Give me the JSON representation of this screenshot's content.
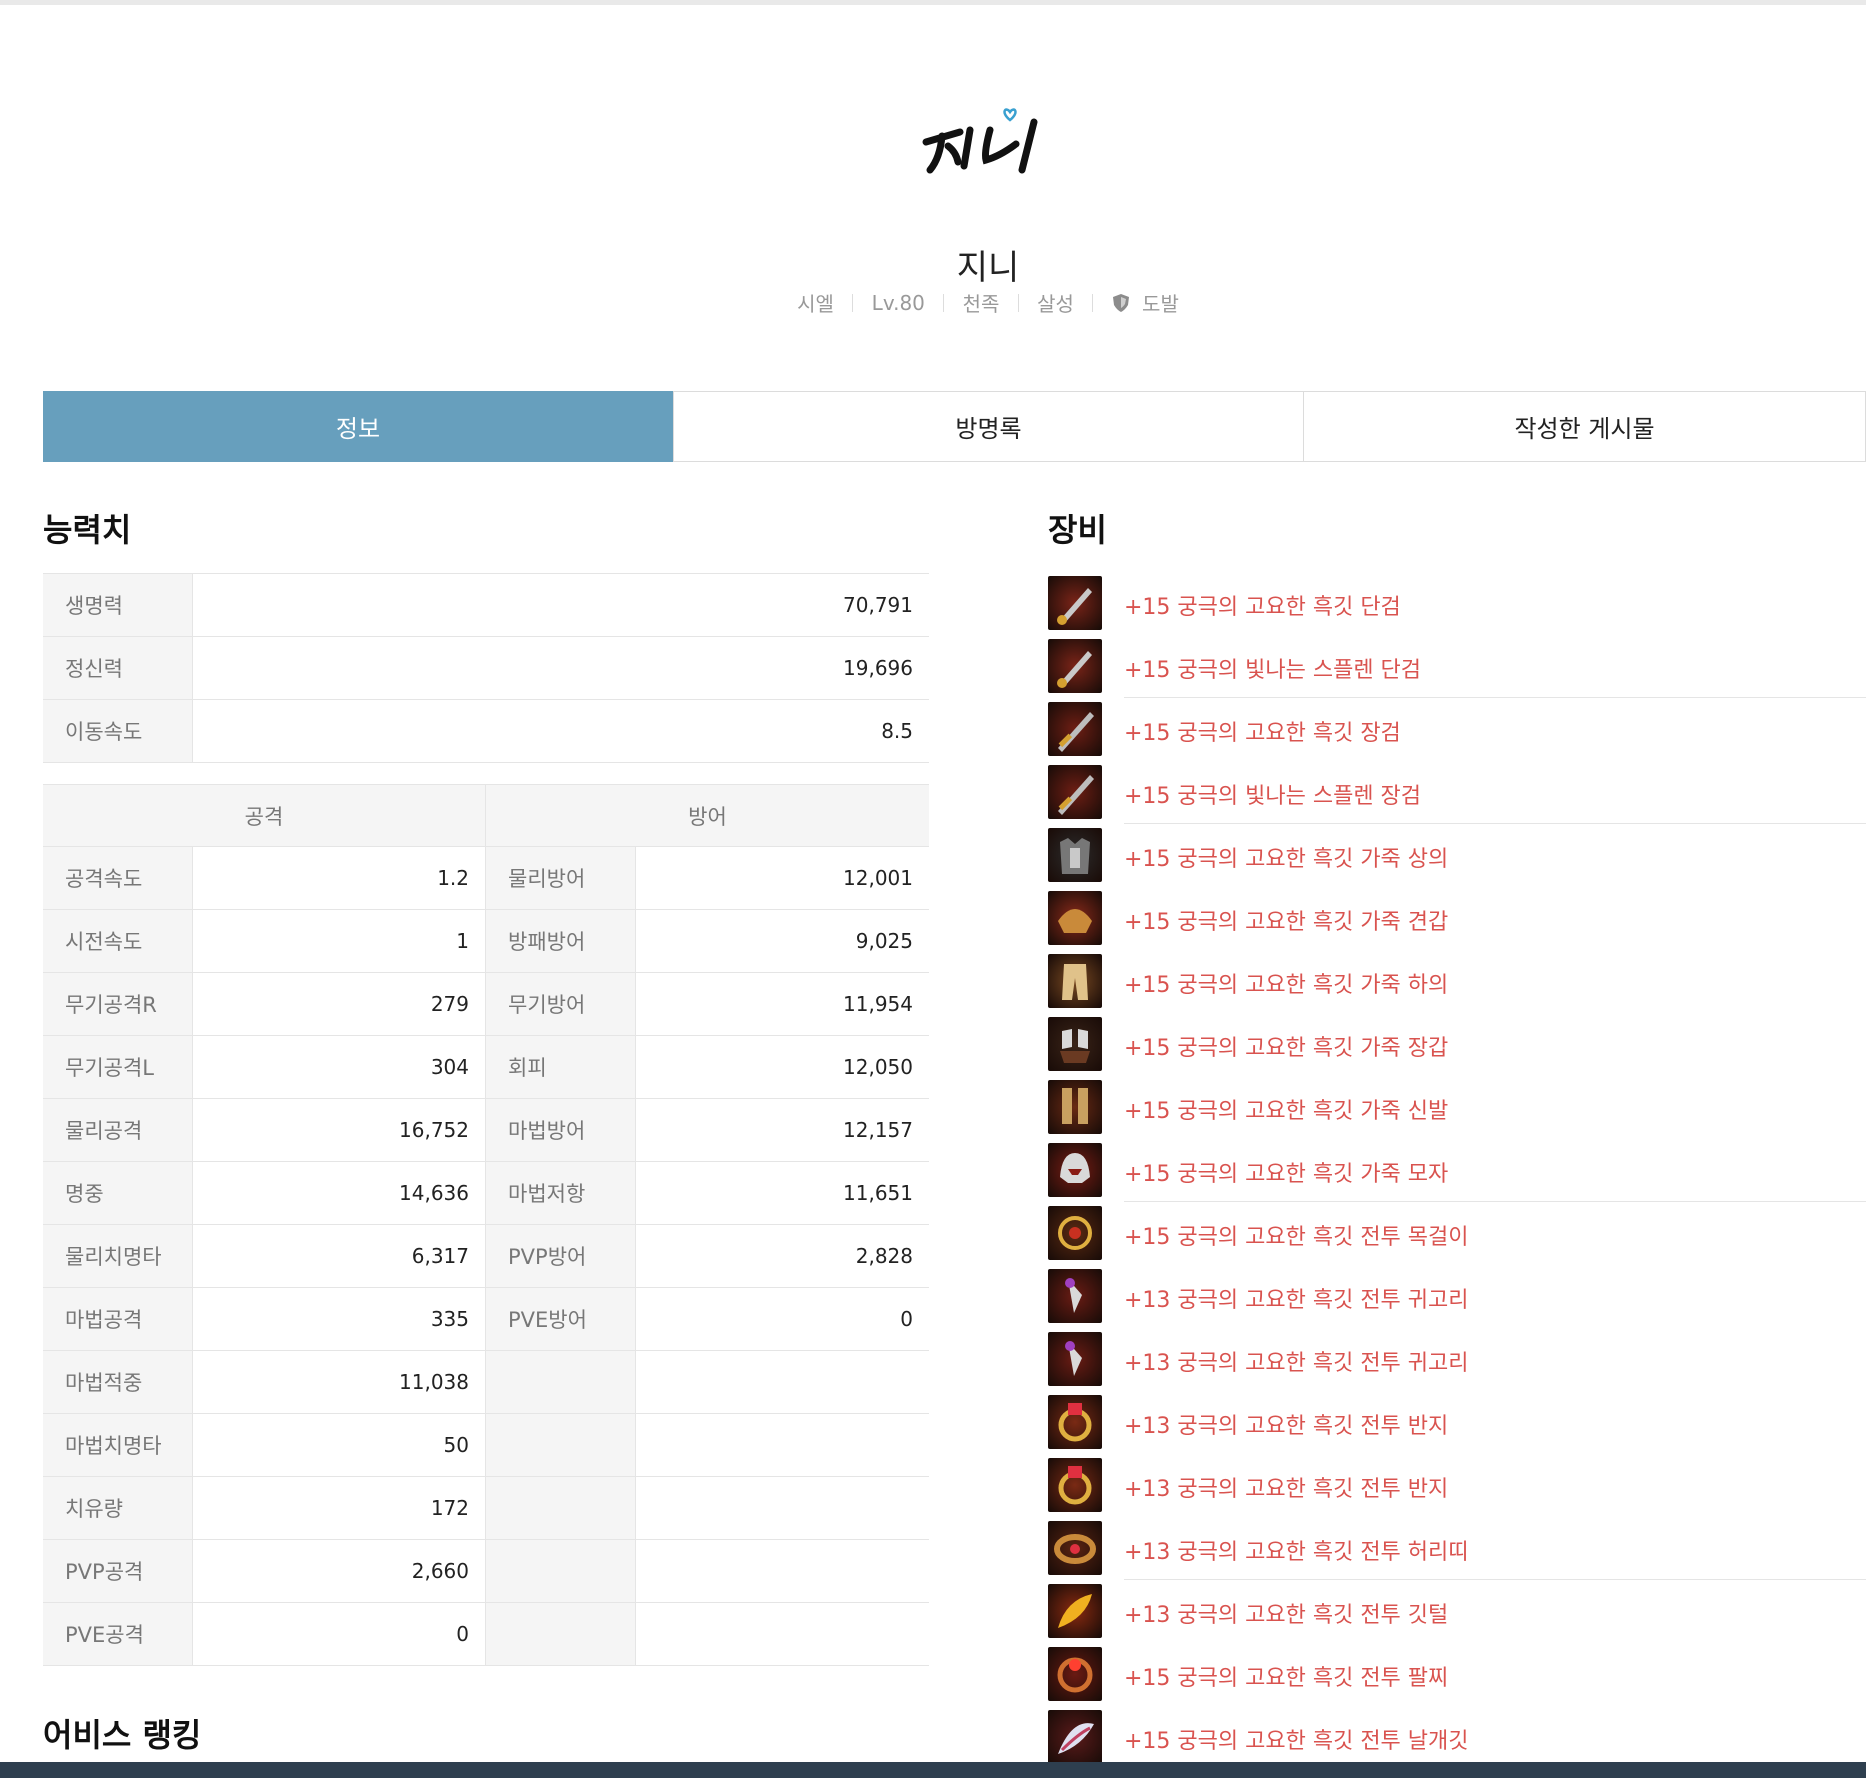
{
  "profile": {
    "logo_text": "지니",
    "name": "지니",
    "server": "시엘",
    "level": "Lv.80",
    "race": "천족",
    "class": "살성",
    "legion": "도발"
  },
  "tabs": [
    {
      "label": "정보",
      "active": true
    },
    {
      "label": "방명록",
      "active": false
    },
    {
      "label": "작성한 게시물",
      "active": false
    }
  ],
  "stats": {
    "title": "능력치",
    "basic": [
      {
        "label": "생명력",
        "value": "70,791"
      },
      {
        "label": "정신력",
        "value": "19,696"
      },
      {
        "label": "이동속도",
        "value": "8.5"
      }
    ],
    "attack_header": "공격",
    "defense_header": "방어",
    "rows": [
      {
        "atk_label": "공격속도",
        "atk_value": "1.2",
        "def_label": "물리방어",
        "def_value": "12,001"
      },
      {
        "atk_label": "시전속도",
        "atk_value": "1",
        "def_label": "방패방어",
        "def_value": "9,025"
      },
      {
        "atk_label": "무기공격R",
        "atk_value": "279",
        "def_label": "무기방어",
        "def_value": "11,954"
      },
      {
        "atk_label": "무기공격L",
        "atk_value": "304",
        "def_label": "회피",
        "def_value": "12,050"
      },
      {
        "atk_label": "물리공격",
        "atk_value": "16,752",
        "def_label": "마법방어",
        "def_value": "12,157"
      },
      {
        "atk_label": "명중",
        "atk_value": "14,636",
        "def_label": "마법저항",
        "def_value": "11,651"
      },
      {
        "atk_label": "물리치명타",
        "atk_value": "6,317",
        "def_label": "PVP방어",
        "def_value": "2,828"
      },
      {
        "atk_label": "마법공격",
        "atk_value": "335",
        "def_label": "PVE방어",
        "def_value": "0"
      },
      {
        "atk_label": "마법적중",
        "atk_value": "11,038",
        "def_label": "",
        "def_value": ""
      },
      {
        "atk_label": "마법치명타",
        "atk_value": "50",
        "def_label": "",
        "def_value": ""
      },
      {
        "atk_label": "치유량",
        "atk_value": "172",
        "def_label": "",
        "def_value": ""
      },
      {
        "atk_label": "PVP공격",
        "atk_value": "2,660",
        "def_label": "",
        "def_value": ""
      },
      {
        "atk_label": "PVE공격",
        "atk_value": "0",
        "def_label": "",
        "def_value": ""
      }
    ]
  },
  "abyss": {
    "title": "어비스 랭킹"
  },
  "equipment": {
    "title": "장비",
    "items": [
      {
        "name": "+15 궁극의 고요한 흑깃 단검",
        "icon": "dagger-icon",
        "color": "#7a2418",
        "rule": false
      },
      {
        "name": "+15 궁극의 빛나는 스플렌 단검",
        "icon": "dagger-icon",
        "color": "#7a2418",
        "rule": true
      },
      {
        "name": "+15 궁극의 고요한 흑깃 장검",
        "icon": "sword-icon",
        "color": "#6e1e14",
        "rule": false
      },
      {
        "name": "+15 궁극의 빛나는 스플렌 장검",
        "icon": "sword-icon",
        "color": "#6e1e14",
        "rule": true
      },
      {
        "name": "+15 궁극의 고요한 흑깃 가죽 상의",
        "icon": "chest-armor-icon",
        "color": "#2c2c2c",
        "rule": false
      },
      {
        "name": "+15 궁극의 고요한 흑깃 가죽 견갑",
        "icon": "shoulder-armor-icon",
        "color": "#8a2a1a",
        "rule": false
      },
      {
        "name": "+15 궁극의 고요한 흑깃 가죽 하의",
        "icon": "leg-armor-icon",
        "color": "#7a4a22",
        "rule": false
      },
      {
        "name": "+15 궁극의 고요한 흑깃 가죽 장갑",
        "icon": "gloves-icon",
        "color": "#3a2418",
        "rule": false
      },
      {
        "name": "+15 궁극의 고요한 흑깃 가죽 신발",
        "icon": "boots-icon",
        "color": "#6a2a14",
        "rule": false
      },
      {
        "name": "+15 궁극의 고요한 흑깃 가죽 모자",
        "icon": "helmet-icon",
        "color": "#7a1c14",
        "rule": true
      },
      {
        "name": "+15 궁극의 고요한 흑깃 전투 목걸이",
        "icon": "necklace-icon",
        "color": "#5a2a12",
        "rule": false
      },
      {
        "name": "+13 궁극의 고요한 흑깃 전투 귀고리",
        "icon": "earring-icon",
        "color": "#6a1c14",
        "rule": false
      },
      {
        "name": "+13 궁극의 고요한 흑깃 전투 귀고리",
        "icon": "earring-icon",
        "color": "#6a1c14",
        "rule": false
      },
      {
        "name": "+13 궁극의 고요한 흑깃 전투 반지",
        "icon": "ring-icon",
        "color": "#7a2a14",
        "rule": false
      },
      {
        "name": "+13 궁극의 고요한 흑깃 전투 반지",
        "icon": "ring-icon",
        "color": "#7a2a14",
        "rule": false
      },
      {
        "name": "+13 궁극의 고요한 흑깃 전투 허리띠",
        "icon": "belt-icon",
        "color": "#5a2412",
        "rule": true
      },
      {
        "name": "+13 궁극의 고요한 흑깃 전투 깃털",
        "icon": "feather-icon",
        "color": "#8a2a10",
        "rule": false
      },
      {
        "name": "+15 궁극의 고요한 흑깃 전투 팔찌",
        "icon": "bracelet-icon",
        "color": "#6a1a12",
        "rule": false
      },
      {
        "name": "+15 궁극의 고요한 흑깃 전투 날개깃",
        "icon": "wing-feather-icon",
        "color": "#5a1a1a",
        "rule": false
      }
    ]
  }
}
